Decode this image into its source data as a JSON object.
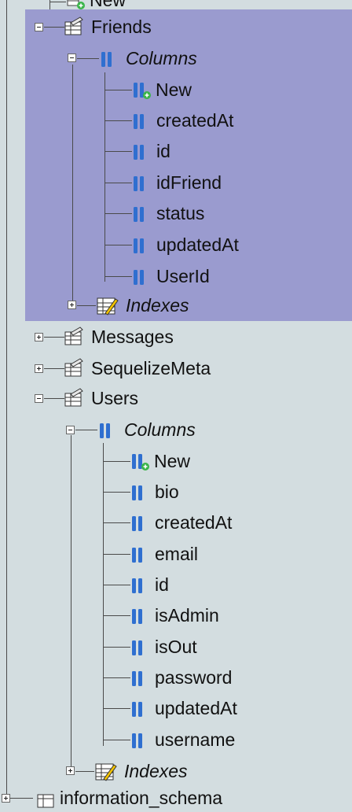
{
  "tree": {
    "partial_top_label": "New",
    "tables": [
      {
        "name": "Friends",
        "expanded": true,
        "selected": true,
        "columns_label": "Columns",
        "columns": [
          "New",
          "createdAt",
          "id",
          "idFriend",
          "status",
          "updatedAt",
          "UserId"
        ],
        "indexes_label": "Indexes"
      },
      {
        "name": "Messages",
        "expanded": false
      },
      {
        "name": "SequelizeMeta",
        "expanded": false
      },
      {
        "name": "Users",
        "expanded": true,
        "selected": false,
        "columns_label": "Columns",
        "columns": [
          "New",
          "bio",
          "createdAt",
          "email",
          "id",
          "isAdmin",
          "isOut",
          "password",
          "updatedAt",
          "username"
        ],
        "indexes_label": "Indexes"
      }
    ],
    "partial_bottom_label": "information_schema"
  },
  "colors": {
    "background": "#d3dde0",
    "selection": "#9a9bcf",
    "column_icon": "#2f6fd0",
    "new_badge": "#3bb54a"
  },
  "icons": {
    "table": "table-icon",
    "columns": "columns-icon",
    "column": "column-icon",
    "new_column": "new-column-icon",
    "indexes": "indexes-icon",
    "expand": "expand-icon",
    "collapse": "collapse-icon",
    "database": "database-icon"
  }
}
